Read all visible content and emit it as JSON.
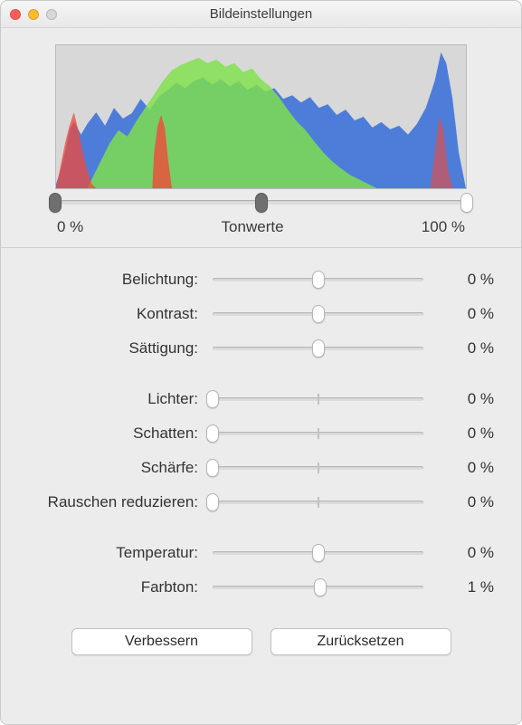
{
  "window": {
    "title": "Bildeinstellungen"
  },
  "levels": {
    "black_pct": 0,
    "mid_pct": 50,
    "white_pct": 100,
    "left_label": "0 %",
    "center_label": "Tonwerte",
    "right_label": "100 %"
  },
  "groups": [
    {
      "rows": [
        {
          "key": "exposure",
          "label": "Belichtung:",
          "value_label": "0 %",
          "pos_pct": 50,
          "tick_pct": 50
        },
        {
          "key": "contrast",
          "label": "Kontrast:",
          "value_label": "0 %",
          "pos_pct": 50,
          "tick_pct": 50
        },
        {
          "key": "saturation",
          "label": "Sättigung:",
          "value_label": "0 %",
          "pos_pct": 50,
          "tick_pct": 50
        }
      ]
    },
    {
      "rows": [
        {
          "key": "highlights",
          "label": "Lichter:",
          "value_label": "0 %",
          "pos_pct": 0,
          "tick_pct": 50
        },
        {
          "key": "shadows",
          "label": "Schatten:",
          "value_label": "0 %",
          "pos_pct": 0,
          "tick_pct": 50
        },
        {
          "key": "sharpness",
          "label": "Schärfe:",
          "value_label": "0 %",
          "pos_pct": 0,
          "tick_pct": 50
        },
        {
          "key": "denoise",
          "label": "Rauschen reduzieren:",
          "value_label": "0 %",
          "pos_pct": 0,
          "tick_pct": 50
        }
      ]
    },
    {
      "rows": [
        {
          "key": "temperature",
          "label": "Temperatur:",
          "value_label": "0 %",
          "pos_pct": 50,
          "tick_pct": 50
        },
        {
          "key": "tint",
          "label": "Farbton:",
          "value_label": "1 %",
          "pos_pct": 51,
          "tick_pct": 50
        }
      ]
    }
  ],
  "footer": {
    "enhance_label": "Verbessern",
    "reset_label": "Zurücksetzen"
  }
}
